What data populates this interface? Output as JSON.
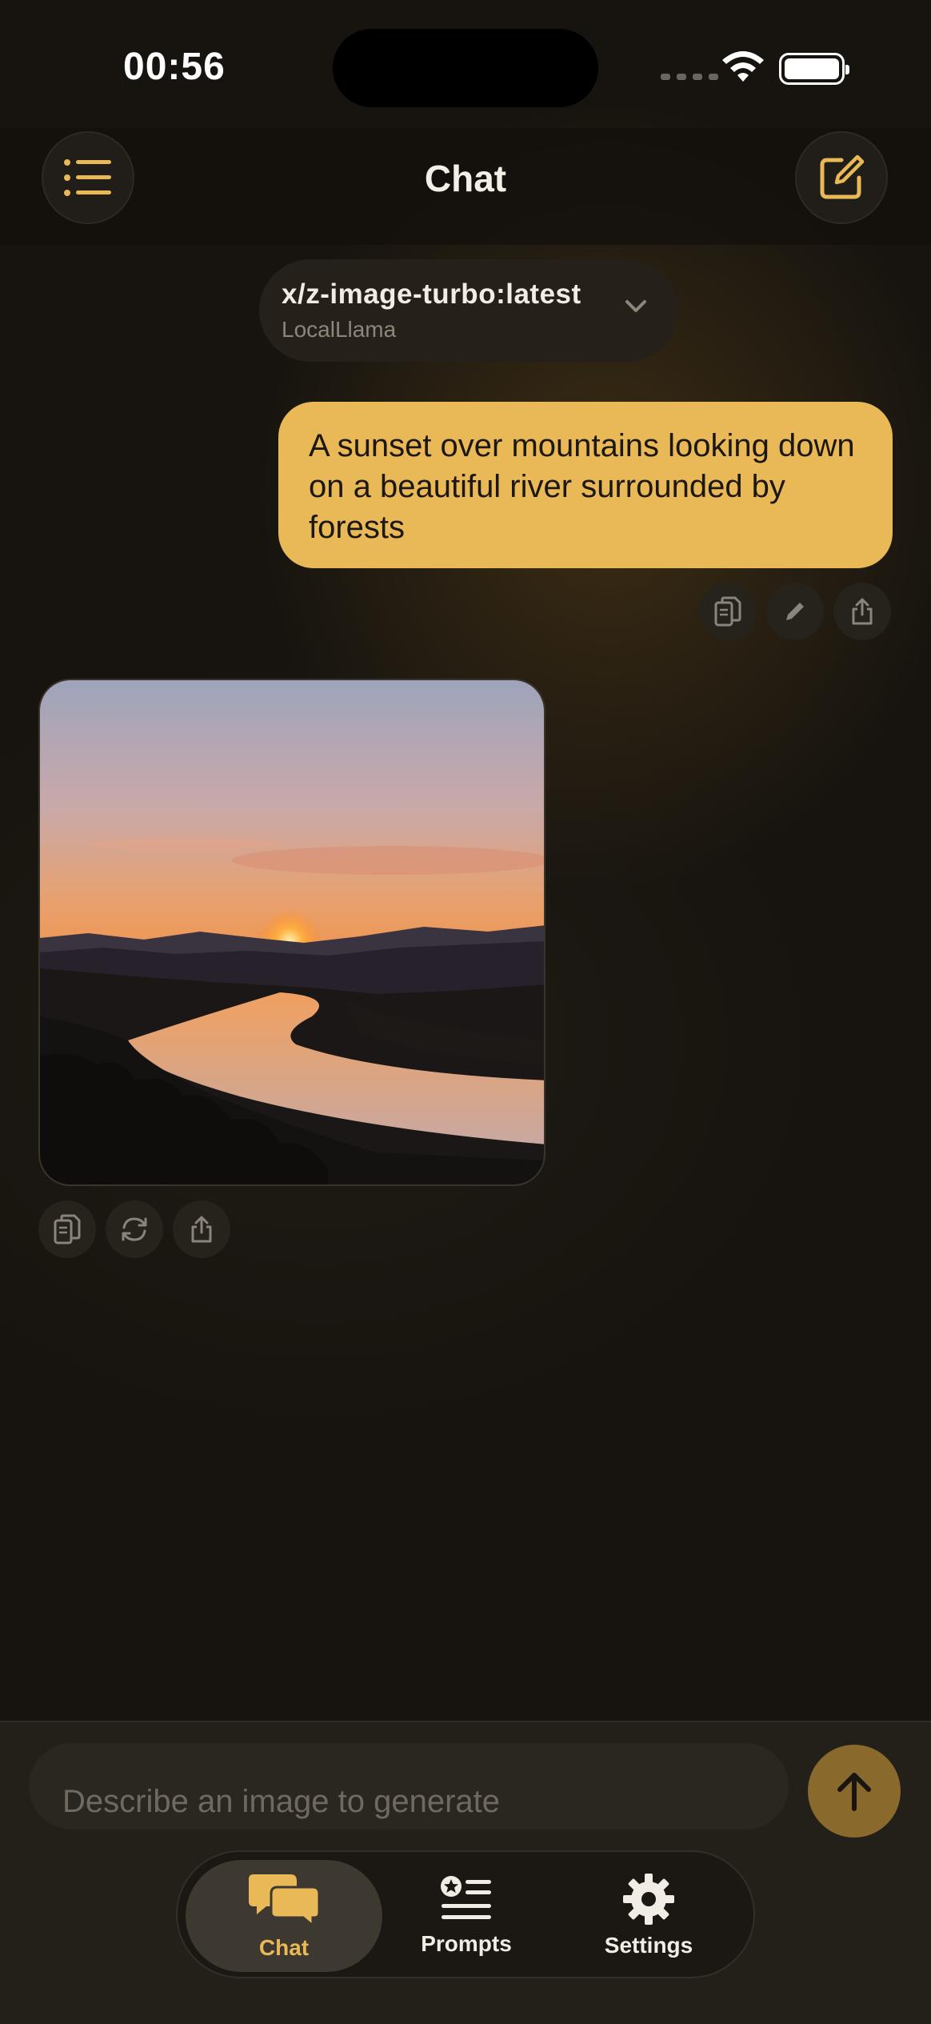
{
  "status_bar": {
    "time": "00:56",
    "icons": [
      "cellular-signal-icon",
      "wifi-icon",
      "battery-icon"
    ]
  },
  "header": {
    "title": "Chat",
    "left_icon": "list-icon",
    "right_icon": "compose-icon"
  },
  "model_selector": {
    "name": "x/z-image-turbo:latest",
    "provider": "LocalLlama",
    "icon": "chevron-down-icon"
  },
  "messages": [
    {
      "role": "user",
      "text": "A sunset over mountains looking down on a beautiful river surrounded by forests",
      "actions": [
        "copy-icon",
        "edit-icon",
        "share-icon"
      ]
    },
    {
      "role": "assistant",
      "content": "generated-image",
      "actions": [
        "copy-icon",
        "regenerate-icon",
        "share-icon"
      ]
    }
  ],
  "composer": {
    "placeholder": "Describe an image to generate",
    "send_icon": "arrow-up-icon"
  },
  "tabs": [
    {
      "label": "Chat",
      "icon": "chat-bubbles-icon",
      "active": true
    },
    {
      "label": "Prompts",
      "icon": "prompts-list-icon",
      "active": false
    },
    {
      "label": "Settings",
      "icon": "gear-icon",
      "active": false
    }
  ],
  "colors": {
    "accent": "#e9b857",
    "background": "#17140f",
    "send_button": "#8a6a2c"
  }
}
